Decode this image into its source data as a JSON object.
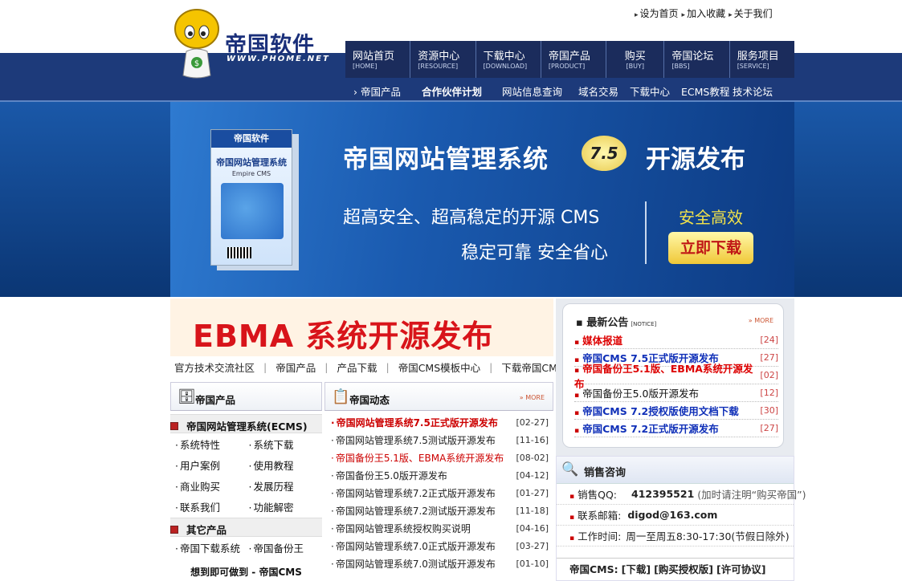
{
  "colors": {
    "navy": "#1b2c5c",
    "accent_red": "#d8141a",
    "notice_blue": "#1030b8",
    "banner_yellow": "#f2e24a"
  },
  "logo": {
    "title": "帝国软件",
    "domain": "WWW.PHOME.NET",
    "mascot_icon": "mascot-icon"
  },
  "toplinks": [
    "设为首页",
    "加入收藏",
    "关于我们"
  ],
  "mainnav": [
    {
      "cn": "网站首页",
      "en": "[HOME]"
    },
    {
      "cn": "资源中心",
      "en": "[RESOURCE]"
    },
    {
      "cn": "下载中心",
      "en": "[DOWNLOAD]"
    },
    {
      "cn": "帝国产品",
      "en": "[PRODUCT]"
    },
    {
      "cn": "购买",
      "en": "[BUY]"
    },
    {
      "cn": "帝国论坛",
      "en": "[BBS]"
    },
    {
      "cn": "服务项目",
      "en": "[SERVICE]"
    }
  ],
  "subnav": [
    "› 帝国产品",
    "合作伙伴计划",
    "网站信息查询",
    "域名交易",
    "下载中心",
    "ECMS教程",
    "技术论坛"
  ],
  "banner": {
    "box_brand": "帝国软件",
    "box_title": "帝国网站管理系统",
    "box_sub": "Empire CMS",
    "title": "帝国网站管理系统",
    "version": "7.5",
    "title2": "开源发布",
    "line1": "超高安全、超高稳定的开源 CMS",
    "line2": "稳定可靠 安全省心",
    "safe": "安全高效",
    "button": "立即下载"
  },
  "ebma": "EBMA 系统开源发布",
  "categories": [
    "官方技术交流社区",
    "帝国产品",
    "产品下载",
    "帝国CMS模板中心",
    "下载帝国CMS"
  ],
  "products": {
    "title": "帝国产品",
    "section1": "帝国网站管理系统(ECMS)",
    "items1": [
      "系统特性",
      "系统下载",
      "用户案例",
      "使用教程",
      "商业购买",
      "发展历程",
      "联系我们",
      "功能解密"
    ],
    "section2": "其它产品",
    "items2": [
      "帝国下载系统",
      "帝国备份王"
    ],
    "slogan": "想到即可做到 - 帝国CMS"
  },
  "news": {
    "title": "帝国动态",
    "more": "MORE",
    "items": [
      {
        "t": "帝国网站管理系统7.5正式版开源发布",
        "d": "[02-27]"
      },
      {
        "t": "帝国网站管理系统7.5测试版开源发布",
        "d": "[11-16]"
      },
      {
        "t": "帝国备份王5.1版、EBMA系统开源发布",
        "d": "[08-02]"
      },
      {
        "t": "帝国备份王5.0版开源发布",
        "d": "[04-12]"
      },
      {
        "t": "帝国网站管理系统7.2正式版开源发布",
        "d": "[01-27]"
      },
      {
        "t": "帝国网站管理系统7.2测试版开源发布",
        "d": "[11-18]"
      },
      {
        "t": "帝国网站管理系统授权购买说明",
        "d": "[04-16]"
      },
      {
        "t": "帝国网站管理系统7.0正式版开源发布",
        "d": "[03-27]"
      },
      {
        "t": "帝国网站管理系统7.0测试版开源发布",
        "d": "[01-10]"
      }
    ]
  },
  "notice": {
    "title": "最新公告",
    "title_en": "[NOTICE]",
    "more": "MORE",
    "items": [
      {
        "t": "媒体报道",
        "d": "[24]"
      },
      {
        "t": "帝国CMS 7.5正式版开源发布",
        "d": "[27]"
      },
      {
        "t": "帝国备份王5.1版、EBMA系统开源发布",
        "d": "[02]"
      },
      {
        "t": "帝国备份王5.0版开源发布",
        "d": "[12]"
      },
      {
        "t": "帝国CMS 7.2授权版使用文档下载",
        "d": "[30]"
      },
      {
        "t": "帝国CMS 7.2正式版开源发布",
        "d": "[27]"
      }
    ]
  },
  "sales": {
    "title": "销售咨询",
    "qq_label": "销售QQ:",
    "qq": "412395521",
    "qq_note": "(加时请注明“购买帝国”)",
    "mail_label": "联系邮箱:",
    "mail": "digod@163.com",
    "time_label": "工作时间:",
    "time": "周一至周五8:30-17:30(节假日除外)",
    "cms_label": "帝国CMS:",
    "cms_links": [
      "[下载]",
      "[购买授权版]",
      "[许可协议]"
    ]
  }
}
